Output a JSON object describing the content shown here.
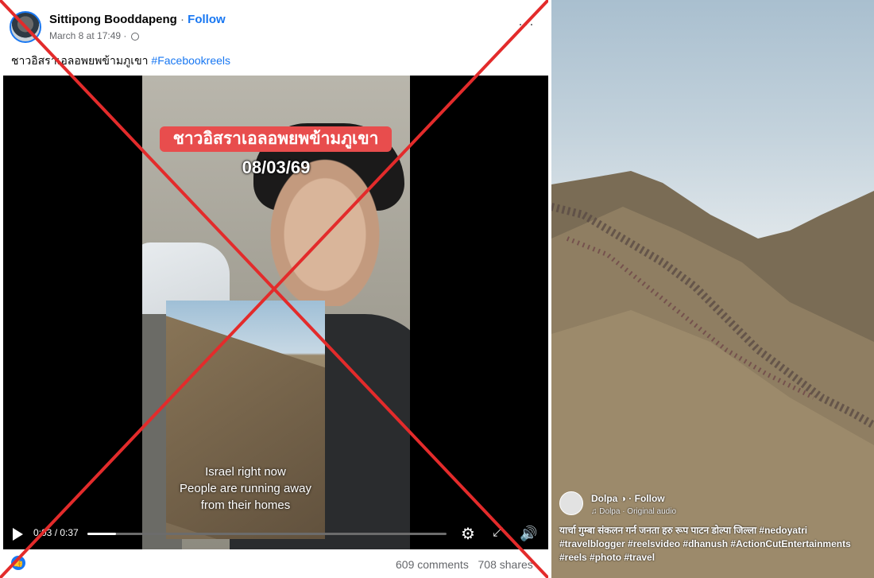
{
  "post": {
    "author": "Sittipong Booddapeng",
    "separator": "·",
    "follow_label": "Follow",
    "timestamp": "March 8 at 17:49 ·",
    "more_label": "···",
    "caption_text": "ชาวอิสราเอลอพยพข้ามภูเขา",
    "caption_hashtag": "#Facebookreels"
  },
  "video": {
    "title_overlay": "ชาวอิสราเอลอพยพข้ามภูเขา",
    "date_overlay": "08/03/69",
    "inset_lines": [
      "Israel right now",
      "People are running away",
      "from their homes"
    ],
    "time_display": "0:03 / 0:37",
    "progress_fraction": 0.08,
    "icons": [
      "play-icon",
      "settings-icon",
      "expand-icon",
      "volume-icon"
    ]
  },
  "footer": {
    "comments": "609 comments",
    "shares": "708 shares"
  },
  "reel": {
    "author": "Dolpa",
    "follow_label": "Follow",
    "audio": "Dolpa · Original audio",
    "caption": "यार्चा गुम्बा संकलन गर्न जनता हरु रूप पाटन डोल्पा जिल्ला #nedoyatri #travelblogger #reelsvideo #dhanush #ActionCutEntertainments #reels #photo #travel"
  },
  "colors": {
    "facebook_blue": "#1877f2",
    "cross_red": "#e32b2b",
    "overlay_red": "#e84d4d"
  }
}
